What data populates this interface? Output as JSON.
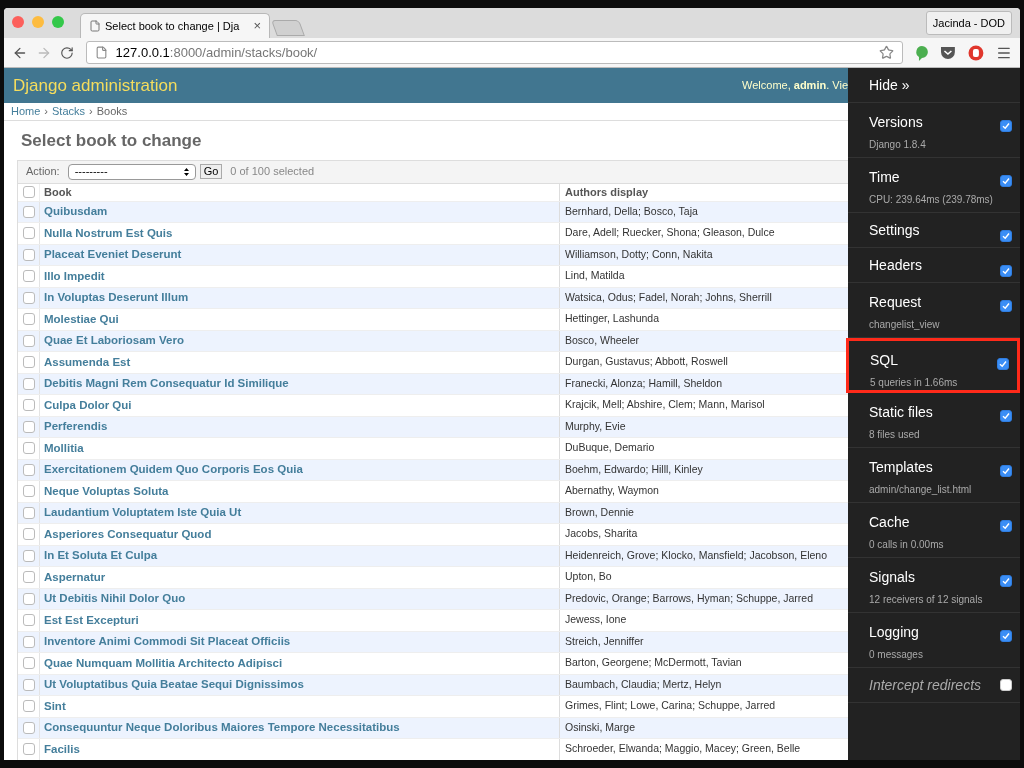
{
  "browser": {
    "tab_title": "Select book to change | Dja",
    "tab_close": "×",
    "profile": "Jacinda - DOD",
    "url_host": "127.0.0.1",
    "url_rest": ":8000/admin/stacks/book/"
  },
  "header": {
    "title": "Django administration",
    "welcome": "Welcome, **admin**. Vie"
  },
  "breadcrumbs": {
    "separator": "›",
    "items": [
      {
        "label": "Home",
        "link": true
      },
      {
        "label": "Stacks",
        "link": true
      },
      {
        "label": "Books",
        "link": false
      }
    ]
  },
  "content": {
    "title": "Select book to change",
    "action_label": "Action:",
    "action_value": "---------",
    "go": "Go",
    "selected_count": "0 of 100 selected"
  },
  "table": {
    "columns": [
      "Book",
      "Authors display"
    ],
    "all_checked": false,
    "rows": [
      {
        "book": "Quibusdam",
        "authors": "Bernhard, Della; Bosco, Taja",
        "checked": false
      },
      {
        "book": "Nulla Nostrum Est Quis",
        "authors": "Dare, Adell; Ruecker, Shona; Gleason, Dulce",
        "checked": false
      },
      {
        "book": "Placeat Eveniet Deserunt",
        "authors": "Williamson, Dotty; Conn, Nakita",
        "checked": false
      },
      {
        "book": "Illo Impedit",
        "authors": "Lind, Matilda",
        "checked": false
      },
      {
        "book": "In Voluptas Deserunt Illum",
        "authors": "Watsica, Odus; Fadel, Norah; Johns, Sherrill",
        "checked": false
      },
      {
        "book": "Molestiae Qui",
        "authors": "Hettinger, Lashunda",
        "checked": false
      },
      {
        "book": "Quae Et Laboriosam Vero",
        "authors": "Bosco, Wheeler",
        "checked": false
      },
      {
        "book": "Assumenda Est",
        "authors": "Durgan, Gustavus; Abbott, Roswell",
        "checked": false
      },
      {
        "book": "Debitis Magni Rem Consequatur Id Similique",
        "authors": "Franecki, Alonza; Hamill, Sheldon",
        "checked": false
      },
      {
        "book": "Culpa Dolor Qui",
        "authors": "Krajcik, Mell; Abshire, Clem; Mann, Marisol",
        "checked": false
      },
      {
        "book": "Perferendis",
        "authors": "Murphy, Evie",
        "checked": false
      },
      {
        "book": "Mollitia",
        "authors": "DuBuque, Demario",
        "checked": false
      },
      {
        "book": "Exercitationem Quidem Quo Corporis Eos Quia",
        "authors": "Boehm, Edwardo; Hilll, Kinley",
        "checked": false
      },
      {
        "book": "Neque Voluptas Soluta",
        "authors": "Abernathy, Waymon",
        "checked": false
      },
      {
        "book": "Laudantium Voluptatem Iste Quia Ut",
        "authors": "Brown, Dennie",
        "checked": false
      },
      {
        "book": "Asperiores Consequatur Quod",
        "authors": "Jacobs, Sharita",
        "checked": false
      },
      {
        "book": "In Et Soluta Et Culpa",
        "authors": "Heidenreich, Grove; Klocko, Mansfield; Jacobson, Eleno",
        "checked": false
      },
      {
        "book": "Aspernatur",
        "authors": "Upton, Bo",
        "checked": false
      },
      {
        "book": "Ut Debitis Nihil Dolor Quo",
        "authors": "Predovic, Orange; Barrows, Hyman; Schuppe, Jarred",
        "checked": false
      },
      {
        "book": "Est Est Excepturi",
        "authors": "Jewess, Ione",
        "checked": false
      },
      {
        "book": "Inventore Animi Commodi Sit Placeat Officiis",
        "authors": "Streich, Jenniffer",
        "checked": false
      },
      {
        "book": "Quae Numquam Mollitia Architecto Adipisci",
        "authors": "Barton, Georgene; McDermott, Tavian",
        "checked": false
      },
      {
        "book": "Ut Voluptatibus Quia Beatae Sequi Dignissimos",
        "authors": "Baumbach, Claudia; Mertz, Helyn",
        "checked": false
      },
      {
        "book": "Sint",
        "authors": "Grimes, Flint; Lowe, Carina; Schuppe, Jarred",
        "checked": false
      },
      {
        "book": "Consequuntur Neque Doloribus Maiores Tempore Necessitatibus",
        "authors": "Osinski, Marge",
        "checked": false
      },
      {
        "book": "Facilis",
        "authors": "Schroeder, Elwanda; Maggio, Macey; Green, Belle",
        "checked": false
      }
    ]
  },
  "debug_toolbar": {
    "hide": "Hide »",
    "panels": [
      {
        "kind": "panel",
        "title": "Versions",
        "subtitle": "Django 1.8.4",
        "checked": true,
        "highlighted": false
      },
      {
        "kind": "panel",
        "title": "Time",
        "subtitle": "CPU: 239.64ms (239.78ms)",
        "checked": true,
        "highlighted": false
      },
      {
        "kind": "panel",
        "title": "Settings",
        "checked": true,
        "highlighted": false
      },
      {
        "kind": "panel",
        "title": "Headers",
        "checked": true,
        "highlighted": false
      },
      {
        "kind": "panel",
        "title": "Request",
        "subtitle": "changelist_view",
        "checked": true,
        "highlighted": false
      },
      {
        "kind": "panel",
        "title": "SQL",
        "subtitle": "5 queries in 1.66ms",
        "checked": true,
        "highlighted": true
      },
      {
        "kind": "panel",
        "title": "Static files",
        "subtitle": "8 files used",
        "checked": true,
        "highlighted": false
      },
      {
        "kind": "panel",
        "title": "Templates",
        "subtitle": "admin/change_list.html",
        "checked": true,
        "highlighted": false
      },
      {
        "kind": "panel",
        "title": "Cache",
        "subtitle": "0 calls in 0.00ms",
        "checked": true,
        "highlighted": false
      },
      {
        "kind": "panel",
        "title": "Signals",
        "subtitle": "12 receivers of 12 signals",
        "checked": true,
        "highlighted": false
      },
      {
        "kind": "panel",
        "title": "Logging",
        "subtitle": "0 messages",
        "checked": true,
        "highlighted": false
      },
      {
        "kind": "option",
        "title": "Intercept redirects",
        "checked": false,
        "highlighted": false
      }
    ]
  }
}
